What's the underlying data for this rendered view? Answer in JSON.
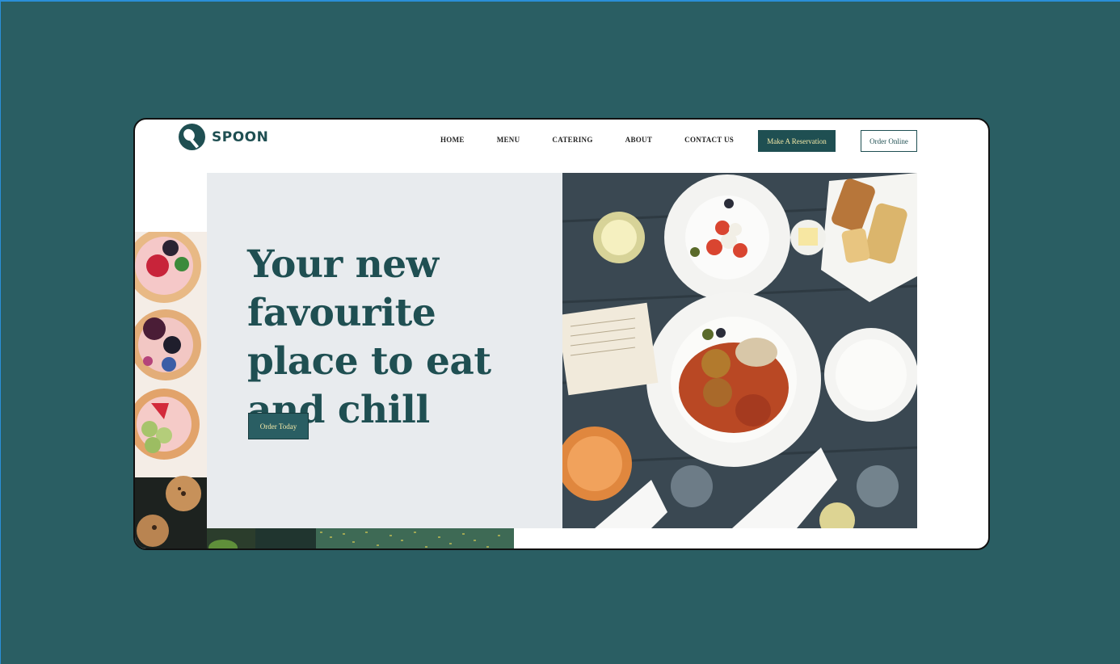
{
  "brand": {
    "name": "SPOON",
    "logo_icon": "spoon-logo-icon"
  },
  "nav": {
    "items": [
      "HOME",
      "MENU",
      "CATERING",
      "ABOUT",
      "CONTACT US"
    ]
  },
  "buttons": {
    "reserve_label": "Make A Reservation",
    "order_online_label": "Order Online",
    "order_today_label": "Order Today"
  },
  "hero": {
    "title": "Your new favourite place to eat and chill"
  },
  "colors": {
    "page_bg": "#2a5e63",
    "brand_dark": "#1f4f52",
    "accent_text": "#f3e9a8",
    "panel_bg": "#e8ebee"
  }
}
